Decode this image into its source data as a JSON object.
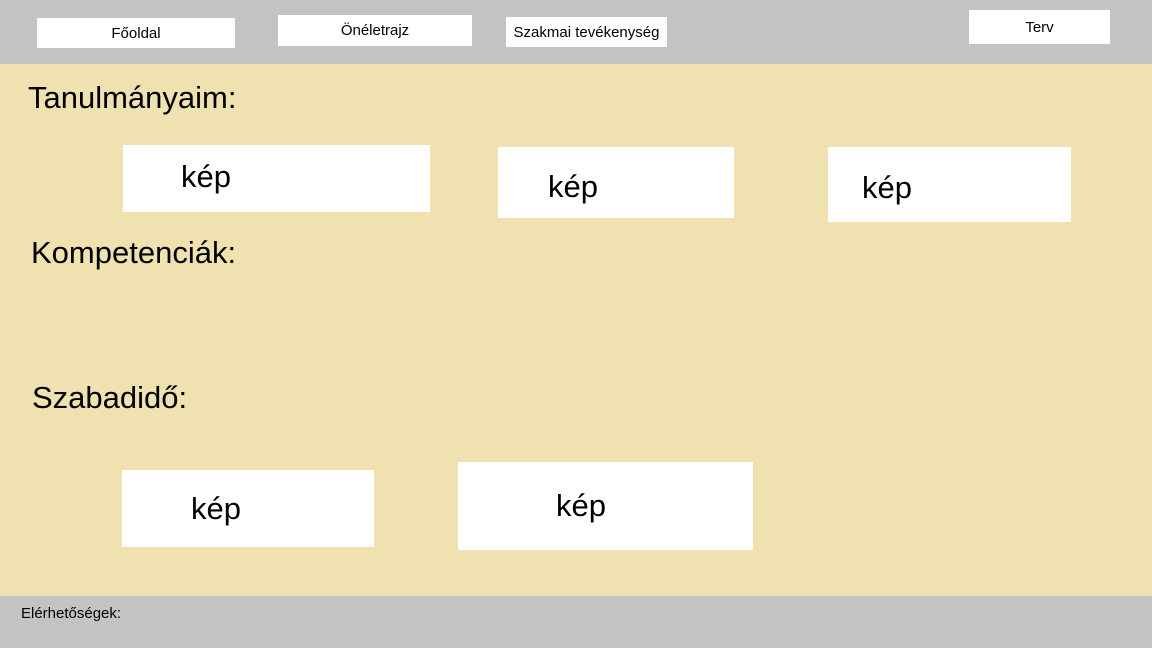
{
  "nav": {
    "items": [
      {
        "label": "Főoldal"
      },
      {
        "label": "Önéletrajz"
      },
      {
        "label": "Szakmai tevékenység"
      },
      {
        "label": "Terv"
      }
    ]
  },
  "sections": {
    "studies": {
      "title": "Tanulmányaim:",
      "images": [
        {
          "label": "kép"
        },
        {
          "label": "kép"
        },
        {
          "label": "kép"
        }
      ]
    },
    "competencies": {
      "title": "Kompetenciák:"
    },
    "leisure": {
      "title": "Szabadidő:",
      "images": [
        {
          "label": "kép"
        },
        {
          "label": "kép"
        }
      ]
    }
  },
  "footer": {
    "contacts_label": "Elérhetőségek:"
  },
  "colors": {
    "bars": "#c3c3c3",
    "content_bg": "#efe2b0",
    "box_bg": "#ffffff"
  }
}
